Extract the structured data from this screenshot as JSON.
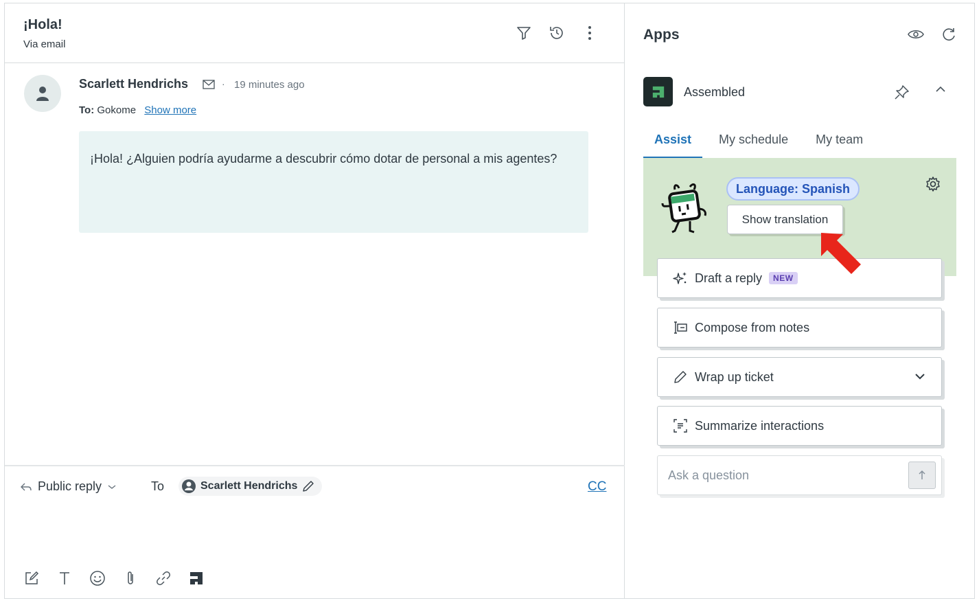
{
  "ticket": {
    "title": "¡Hola!",
    "channel": "Via email"
  },
  "message": {
    "sender": "Scarlett Hendrichs",
    "separator": "·",
    "time": "19 minutes ago",
    "to_label": "To:",
    "to_value": "Gokome",
    "show_more": "Show more",
    "body": "¡Hola! ¿Alguien podría ayudarme a descubrir cómo dotar de personal a mis agentes?"
  },
  "reply": {
    "type_label": "Public reply",
    "to_label": "To",
    "recipient": "Scarlett Hendrichs",
    "cc_label": "CC"
  },
  "apps": {
    "title": "Apps",
    "app_name": "Assembled",
    "tabs": [
      {
        "label": "Assist",
        "active": true
      },
      {
        "label": "My schedule",
        "active": false
      },
      {
        "label": "My team",
        "active": false
      }
    ],
    "language_badge": "Language: Spanish",
    "show_translation": "Show translation",
    "actions": {
      "draft_reply": "Draft a reply",
      "new_badge": "NEW",
      "compose": "Compose from notes",
      "wrap_up": "Wrap up ticket",
      "summarize": "Summarize interactions"
    },
    "ask_placeholder": "Ask a question"
  },
  "colors": {
    "accent": "#1f73b7",
    "assist_bg": "#d5e7cf",
    "message_bg": "#e9f4f4",
    "arrow": "#e8251b",
    "logo_bg": "#1e2a2b"
  },
  "icons": [
    "filter-icon",
    "history-icon",
    "more-vertical-icon",
    "user-icon",
    "mail-icon",
    "reply-arrow-icon",
    "chevron-down-icon",
    "pencil-icon",
    "eye-icon",
    "refresh-icon",
    "pin-icon",
    "chevron-up-icon",
    "gear-icon",
    "sparkle-icon",
    "compose-notes-icon",
    "summarize-icon",
    "send-arrow-icon",
    "edit-icon",
    "text-format-icon",
    "emoji-icon",
    "attachment-icon",
    "link-icon",
    "assembled-logo-icon"
  ]
}
